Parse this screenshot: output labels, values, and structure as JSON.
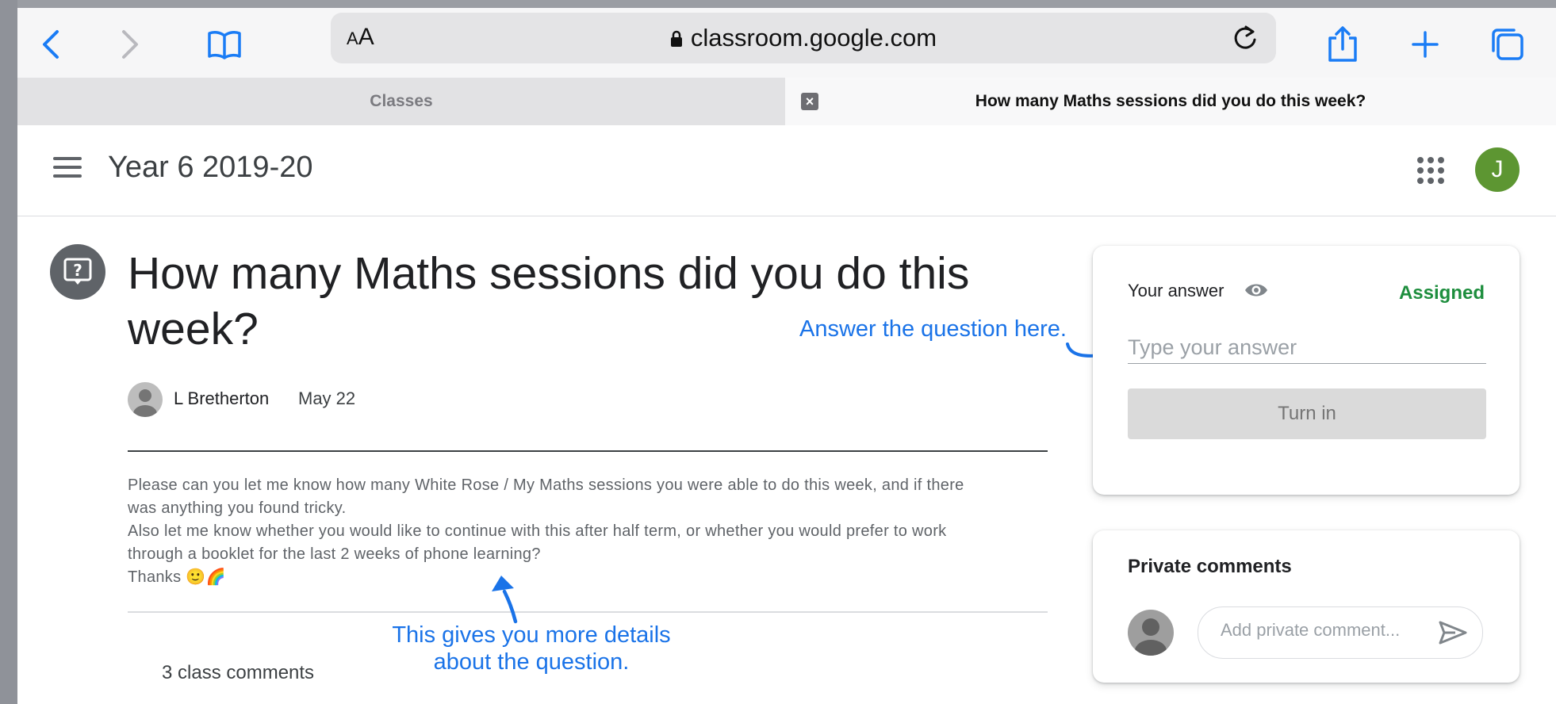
{
  "browser": {
    "text_size_label": "AA",
    "url": "classroom.google.com",
    "tabs": [
      {
        "label": "Classes",
        "active": false
      },
      {
        "label": "How many Maths sessions did you do this week?",
        "active": true
      }
    ],
    "icons": [
      "back-icon",
      "forward-icon",
      "bookmarks-icon",
      "lock-icon",
      "reload-icon",
      "share-icon",
      "new-tab-icon",
      "tabs-overview-icon",
      "close-tab-icon"
    ]
  },
  "header": {
    "class_name": "Year 6 2019-20",
    "user_initial": "J",
    "user_color": "#5d9632"
  },
  "question": {
    "title": "How many Maths sessions did you do this week?",
    "author": "L Bretherton",
    "date": "May 22",
    "description": [
      "Please can you let me know how many White Rose / My Maths sessions you were able to do this week, and if there",
      "was anything you found tricky.",
      "Also let me know whether you would like to continue with this after half term, or whether you would prefer to work",
      "through a booklet for the last 2 weeks of phone learning?",
      "Thanks 🙂🌈"
    ],
    "class_comments": "3 class comments"
  },
  "answer_card": {
    "label": "Your answer",
    "status": "Assigned",
    "status_color": "#1e8e3e",
    "input_value": "",
    "input_placeholder": "Type your answer",
    "turn_in_label": "Turn in"
  },
  "private_comments": {
    "title": "Private comments",
    "input_value": "",
    "input_placeholder": "Add private comment..."
  },
  "annotations": {
    "answer_hint": "Answer the question here.",
    "details_hint": [
      "This gives you more details",
      "about the question."
    ],
    "color": "#1a73e8"
  }
}
